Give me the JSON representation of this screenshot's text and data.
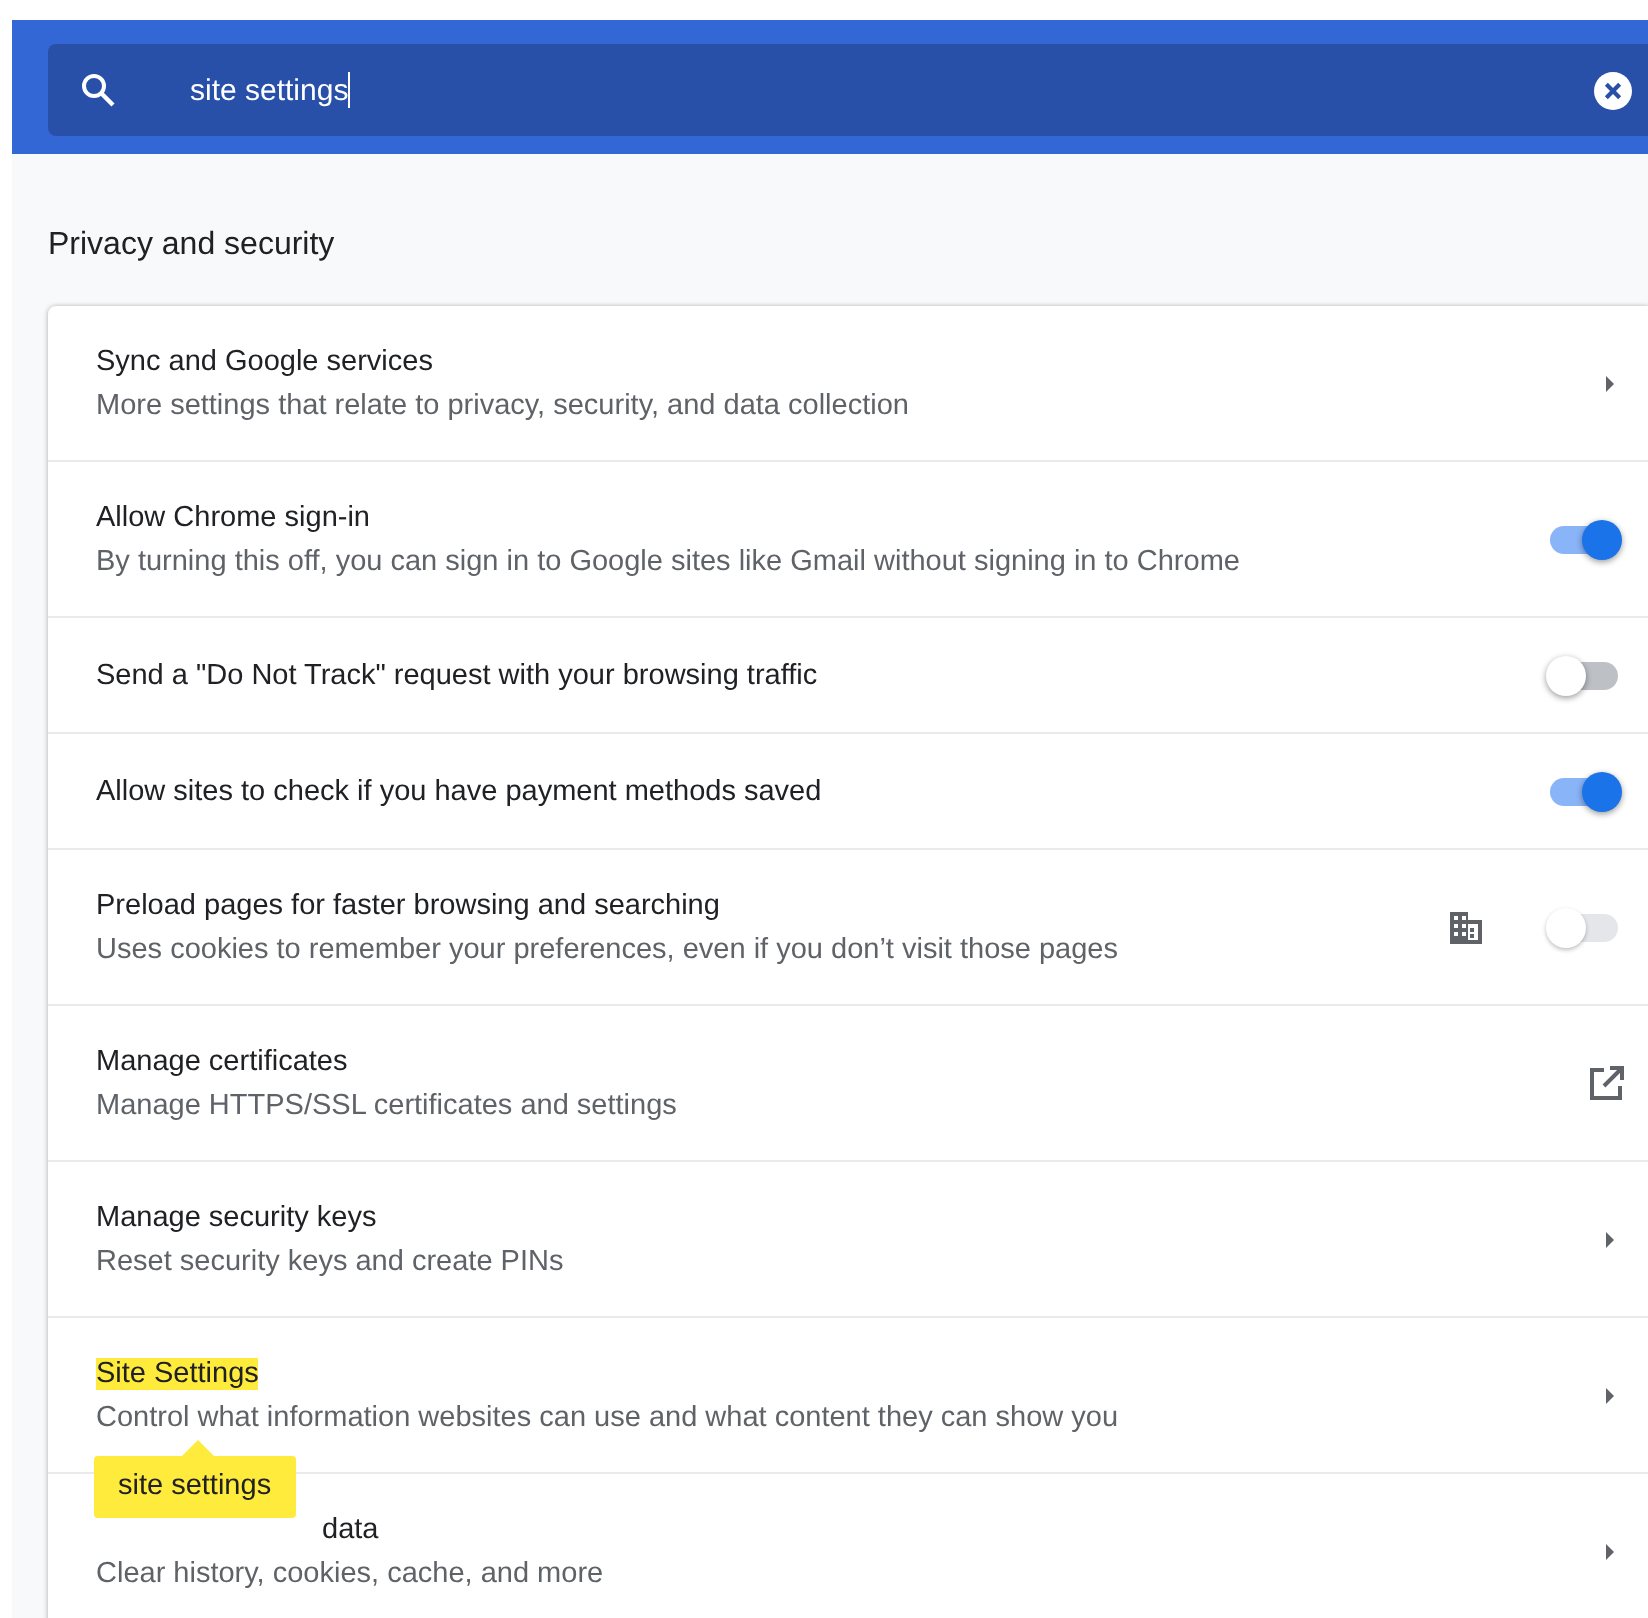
{
  "search": {
    "value": "site settings"
  },
  "section": {
    "title": "Privacy and security"
  },
  "rows": [
    {
      "kind": "arrow",
      "title": "Sync and Google services",
      "subtitle": "More settings that relate to privacy, security, and data collection"
    },
    {
      "kind": "toggle",
      "title": "Allow Chrome sign-in",
      "subtitle": "By turning this off, you can sign in to Google sites like Gmail without signing in to Chrome",
      "on": true
    },
    {
      "kind": "toggle",
      "title": "Send a \"Do Not Track\" request with your browsing traffic",
      "on": false
    },
    {
      "kind": "toggle",
      "title": "Allow sites to check if you have payment methods saved",
      "on": true
    },
    {
      "kind": "toggle",
      "title": "Preload pages for faster browsing and searching",
      "subtitle": "Uses cookies to remember your preferences, even if you don’t visit those pages",
      "on": false,
      "managed": true,
      "disabled": true
    },
    {
      "kind": "external",
      "title": "Manage certificates",
      "subtitle": "Manage HTTPS/SSL certificates and settings"
    },
    {
      "kind": "arrow",
      "title": "Manage security keys",
      "subtitle": "Reset security keys and create PINs"
    },
    {
      "kind": "arrow",
      "title": "Site Settings",
      "subtitle": "Control what information websites can use and what content they can show you",
      "highlighted": true,
      "tooltip": "site settings"
    },
    {
      "kind": "arrow",
      "title": "data",
      "subtitle": "Clear history, cookies, cache, and more",
      "title_covered": true
    }
  ]
}
